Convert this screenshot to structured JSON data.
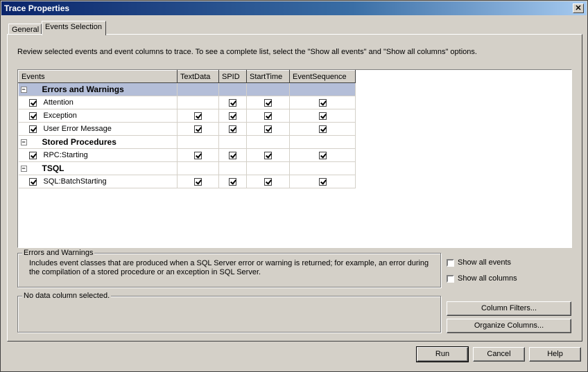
{
  "window": {
    "title": "Trace Properties",
    "close_glyph": "✕"
  },
  "tabs": [
    {
      "label": "General"
    },
    {
      "label": "Events Selection"
    }
  ],
  "intro": "Review selected events and event columns to trace. To see a complete list, select the \"Show all events\" and \"Show all columns\" options.",
  "grid": {
    "columns": [
      "Events",
      "TextData",
      "SPID",
      "StartTime",
      "EventSequence"
    ],
    "rows": [
      {
        "type": "category",
        "label": "Errors and Warnings",
        "expander": "−",
        "selected": true
      },
      {
        "type": "event",
        "label": "Attention",
        "checked": true,
        "cols": [
          false,
          true,
          true,
          true
        ]
      },
      {
        "type": "event",
        "label": "Exception",
        "checked": true,
        "cols": [
          true,
          true,
          true,
          true
        ]
      },
      {
        "type": "event",
        "label": "User Error Message",
        "checked": true,
        "cols": [
          true,
          true,
          true,
          true
        ]
      },
      {
        "type": "category",
        "label": "Stored Procedures",
        "expander": "−",
        "selected": false
      },
      {
        "type": "event",
        "label": "RPC:Starting",
        "checked": true,
        "cols": [
          true,
          true,
          true,
          true
        ]
      },
      {
        "type": "category",
        "label": "TSQL",
        "expander": "−",
        "selected": false
      },
      {
        "type": "event",
        "label": "SQL:BatchStarting",
        "checked": true,
        "cols": [
          true,
          true,
          true,
          true
        ]
      }
    ]
  },
  "description": {
    "legend": "Errors and Warnings",
    "text": "Includes event classes that are produced when a SQL Server error or warning is returned; for example, an error during the compilation of a stored procedure or an exception in SQL Server."
  },
  "column_info": {
    "legend": "No data column selected."
  },
  "options": {
    "show_all_events": "Show all events",
    "show_all_columns": "Show all columns"
  },
  "buttons": {
    "column_filters": "Column Filters...",
    "organize_columns": "Organize Columns...",
    "run": "Run",
    "cancel": "Cancel",
    "help": "Help"
  }
}
